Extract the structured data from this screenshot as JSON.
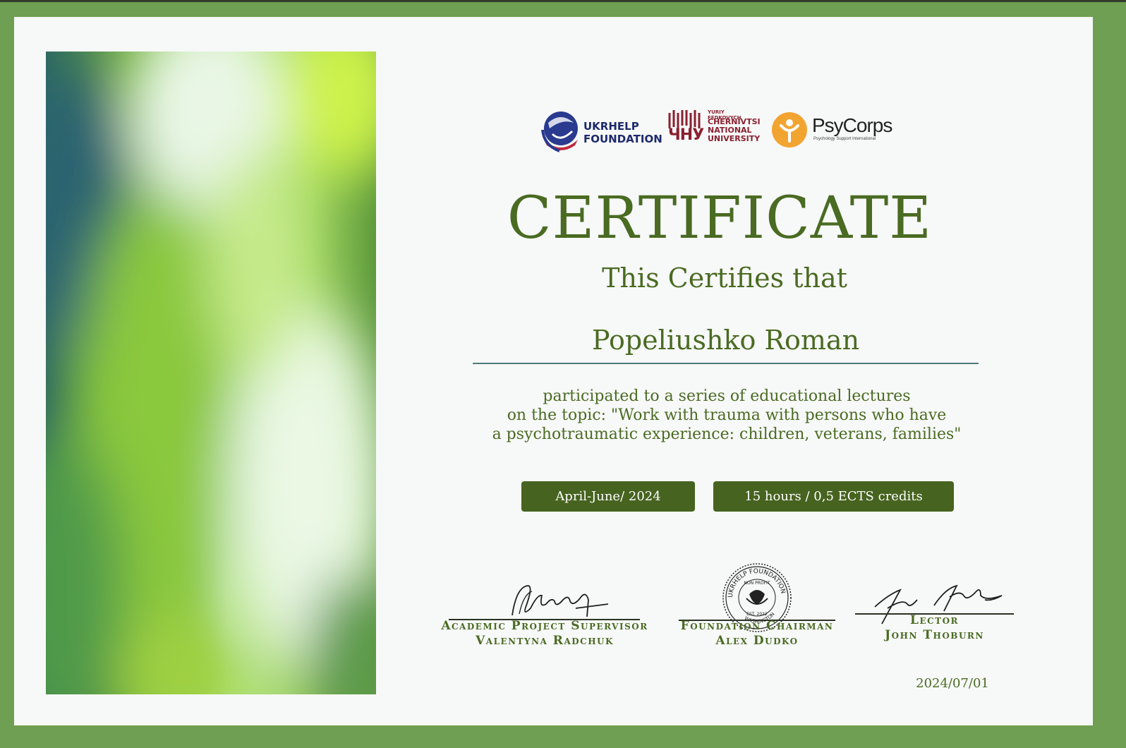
{
  "certificate": {
    "title": "CERTIFICATE",
    "subtitle": "This Certifies that",
    "recipient": "Popeliushko Roman",
    "description_lines": [
      "participated to a series of educational lectures",
      "on the topic: \"Work with trauma with persons who have",
      "a psychotraumatic experience: children, veterans, families\""
    ],
    "period": "April-June/ 2024",
    "credits": "15 hours / 0,5 ECTS credits",
    "date": "2024/07/01"
  },
  "logos": {
    "ukrhelp": {
      "line1": "UKRHELP",
      "line2": "FOUNDATION",
      "icon": "globe-hands-icon"
    },
    "chernivtsi": {
      "top": "YURIY FEDKOVYCH",
      "line1": "CHERNIVTSI",
      "line2": "NATIONAL",
      "line3": "UNIVERSITY",
      "mark": "ЧНУ"
    },
    "psycorps": {
      "name": "PsyCorps",
      "tagline": "Psychology Support International",
      "icon": "person-circle-icon"
    }
  },
  "signatures": [
    {
      "role": "Academic Project Supervisor",
      "name": "Valentyna Radchuk"
    },
    {
      "role": "Foundation Chairman",
      "name": "Alex Dudko"
    },
    {
      "role": "Lector",
      "name": "John Thoburn"
    }
  ],
  "stamp": {
    "outer_text": "UKRHELP FOUNDATION",
    "inner_text": "NON PROFIT",
    "est": "EST. 2022",
    "city": "WASHINGTON"
  },
  "colors": {
    "border": "#6f9f52",
    "text_green": "#4a6b22",
    "pill_green": "#46631f"
  }
}
